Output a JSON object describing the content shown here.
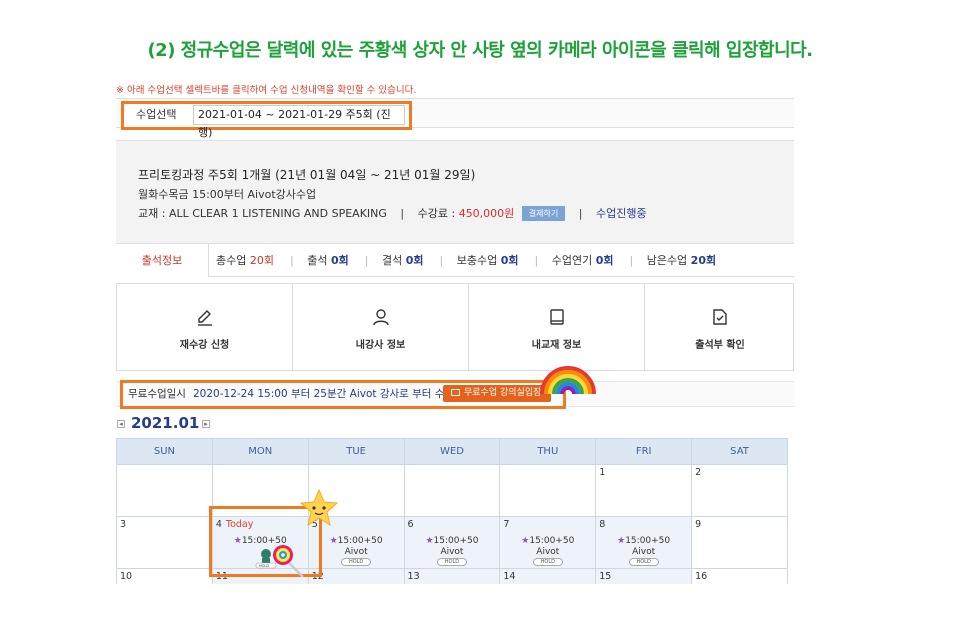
{
  "heading": "(2) 정규수업은 달력에 있는 주황색 상자 안 사탕 옆의 카메라 아이콘을 클릭해 입장합니다.",
  "notice": "※ 아래 수업선택 셀렉트바를 클릭하여 수업 신청내역을 확인할 수 있습니다.",
  "course_select": {
    "label": "수업선택",
    "value": "2021-01-04 ~ 2021-01-29 주5회 (진행)"
  },
  "course": {
    "title": "프리토킹과정 주5회 1개월 (21년 01월 04일 ~ 21년 01월 29일)",
    "time": "월화수목금 15:00부터 Aivot강사수업",
    "textbook": "교재 : ALL CLEAR 1 LISTENING AND SPEAKING",
    "fee_label": "수강료 :",
    "fee": "450,000원",
    "pay_button": "결제하기",
    "status": "수업진행중"
  },
  "attendance": {
    "tab": "출석정보",
    "items": [
      {
        "label": "총수업",
        "value": "20회"
      },
      {
        "label": "출석",
        "value": "0회"
      },
      {
        "label": "결석",
        "value": "0회"
      },
      {
        "label": "보충수업",
        "value": "0회"
      },
      {
        "label": "수업연기",
        "value": "0회"
      },
      {
        "label": "남은수업",
        "value": "20회"
      }
    ]
  },
  "menu": [
    {
      "label": "재수강 신청",
      "icon": "pencil-icon"
    },
    {
      "label": "내강사 정보",
      "icon": "person-icon"
    },
    {
      "label": "내교재 정보",
      "icon": "book-icon"
    },
    {
      "label": "출석부 확인",
      "icon": "document-check-icon"
    }
  ],
  "free_lesson": {
    "label": "무료수업일시",
    "value": "2020-12-24  15:00 부터 25분간 Aivot 강사로 부터 수업",
    "button": "무료수업 강의실입장"
  },
  "calendar": {
    "month": "2021.01",
    "weekdays": [
      "SUN",
      "MON",
      "TUE",
      "WED",
      "THU",
      "FRI",
      "SAT"
    ],
    "today_label": "Today",
    "lesson_time": "15:00+50",
    "tutor": "Aivot",
    "hold": "HOLD",
    "week1": [
      "",
      "",
      "",
      "",
      "",
      "1",
      "2"
    ],
    "week2": [
      "3",
      "4",
      "5",
      "6",
      "7",
      "8",
      "9"
    ],
    "week3": [
      "10",
      "11",
      "12",
      "13",
      "14",
      "15",
      "16"
    ]
  },
  "colors": {
    "heading": "#1fa13a",
    "highlight": "#f07a22",
    "accent": "#263c8f",
    "price": "#d32f2f"
  }
}
